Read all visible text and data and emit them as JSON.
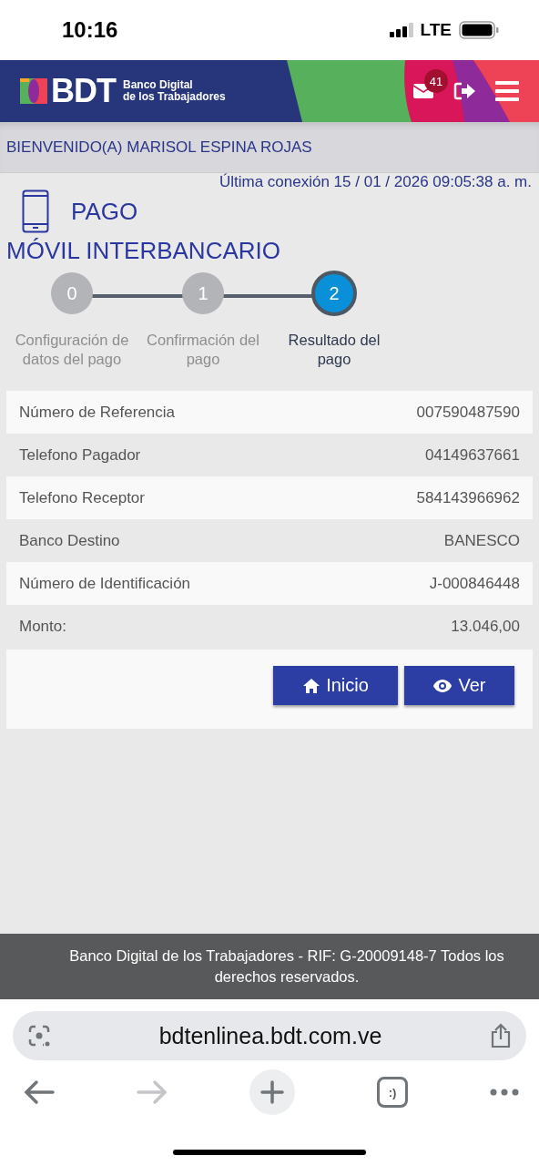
{
  "status_bar": {
    "time": "10:16",
    "network": "LTE"
  },
  "header": {
    "logo_text": "BDT",
    "logo_subtitle_1": "Banco Digital",
    "logo_subtitle_2": "de los Trabajadores",
    "mail_badge": "41"
  },
  "welcome": "BIENVENIDO(A) MARISOL ESPINA ROJAS",
  "last_connection": "Última conexión 15 / 01 / 2026 09:05:38 a. m.",
  "title_1": "PAGO",
  "title_2": "MÓVIL INTERBANCARIO",
  "steps": [
    {
      "number": "0",
      "label": "Configuración de datos del pago",
      "selected": false
    },
    {
      "number": "1",
      "label": "Confirmación del pago",
      "selected": false
    },
    {
      "number": "2",
      "label": "Resultado del pago",
      "selected": true
    }
  ],
  "details": [
    {
      "label": "Número de Referencia",
      "value": "007590487590"
    },
    {
      "label": "Telefono Pagador",
      "value": "04149637661"
    },
    {
      "label": "Telefono Receptor",
      "value": "584143966962"
    },
    {
      "label": "Banco Destino",
      "value": "BANESCO"
    },
    {
      "label": "Número de Identificación",
      "value": "J-000846448"
    },
    {
      "label": "Monto:",
      "value": "13.046,00"
    }
  ],
  "buttons": [
    {
      "kind": "home",
      "label": "Inicio"
    },
    {
      "kind": "view",
      "label": "Ver"
    }
  ],
  "footer": "Banco Digital de los Trabajadores - RIF: G-20009148-7 Todos los derechos reservados.",
  "browser": {
    "url": "bdtenlinea.bdt.com.ve",
    "tabs_label": ":)"
  }
}
